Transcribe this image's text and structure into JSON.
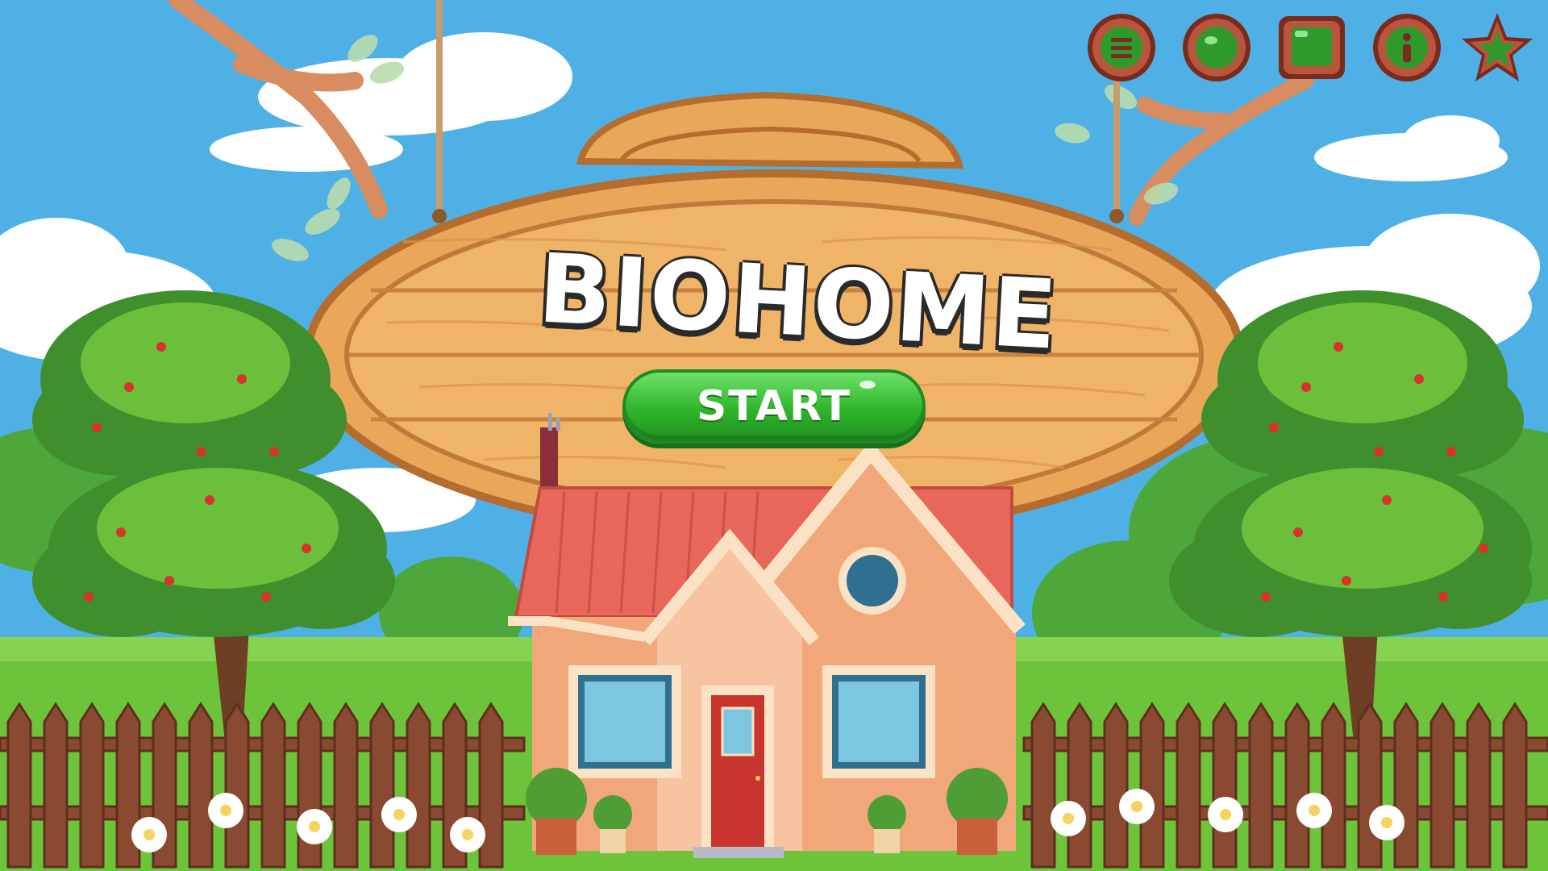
{
  "game": {
    "title": "BIOHOME",
    "start_label": "START"
  },
  "toolbar": {
    "buttons": [
      {
        "icon": "menu-icon"
      },
      {
        "icon": "circle-icon"
      },
      {
        "icon": "square-icon"
      },
      {
        "icon": "info-icon"
      },
      {
        "icon": "star-icon"
      }
    ]
  },
  "colors": {
    "sky": "#4fb0e6",
    "grass": "#6dc43a",
    "wood": "#e8a85a",
    "start_button": "#2fb52c",
    "fence": "#8a4a32",
    "house_wall": "#f2a77a",
    "roof": "#e8675a"
  }
}
